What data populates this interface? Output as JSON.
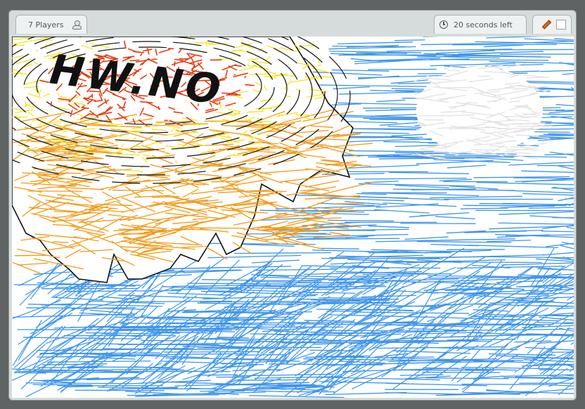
{
  "header": {
    "players_label": "7 Players",
    "timer_label": "20 seconds left"
  },
  "icons": {
    "players": "player-icon",
    "timer": "clock-icon",
    "tool": "pencil-icon",
    "color": "color-swatch"
  },
  "drawing": {
    "scribble_text": "HW.NO",
    "colors": {
      "ocean": "#3e95ea",
      "sun_outline": "#111111",
      "sun_orange": "#f29a18",
      "sun_yellow": "#f6e51a",
      "sun_red": "#e63b12",
      "cloud": "#e2e2e2"
    },
    "selected_color": "#ffffff"
  }
}
